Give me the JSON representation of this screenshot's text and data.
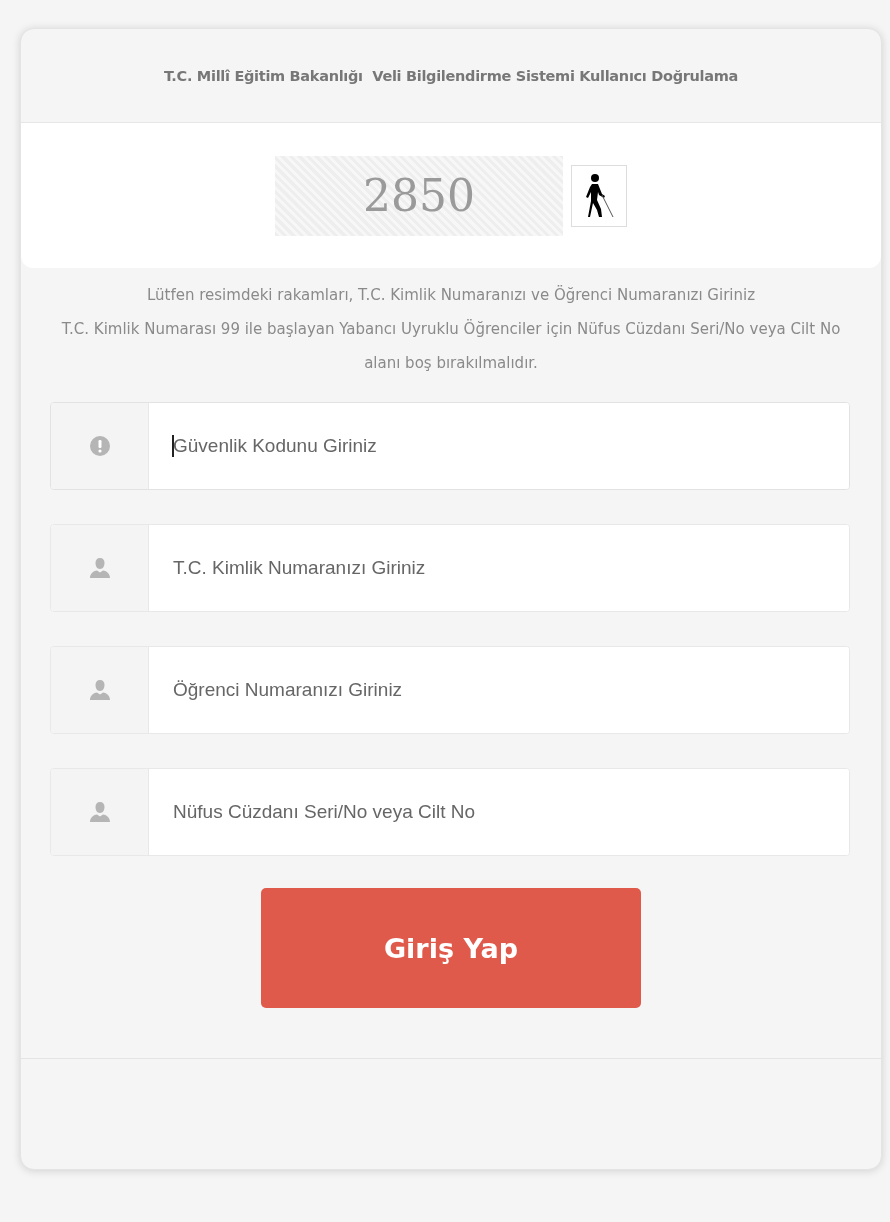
{
  "header": {
    "title": "T.C. Millî Eğitim Bakanlığı  Veli Bilgilendirme Sistemi Kullanıcı Doğrulama"
  },
  "captcha": {
    "code": "2850"
  },
  "instructions": [
    "Lütfen resimdeki rakamları, T.C. Kimlik Numaranızı ve Öğrenci Numaranızı Giriniz",
    "T.C. Kimlik Numarası 99 ile başlayan Yabancı Uyruklu Öğrenciler için Nüfus Cüzdanı Seri/No veya Cilt No alanı boş bırakılmalıdır."
  ],
  "fields": [
    {
      "kind": "alert",
      "placeholder": "Güvenlik Kodunu Giriniz",
      "focused": true
    },
    {
      "kind": "user",
      "placeholder": "T.C. Kimlik Numaranızı Giriniz",
      "focused": false
    },
    {
      "kind": "user",
      "placeholder": "Öğrenci Numaranızı Giriniz",
      "focused": false
    },
    {
      "kind": "user",
      "placeholder": "Nüfus Cüzdanı Seri/No veya Cilt No",
      "focused": false
    }
  ],
  "submit": {
    "label": "Giriş Yap"
  }
}
